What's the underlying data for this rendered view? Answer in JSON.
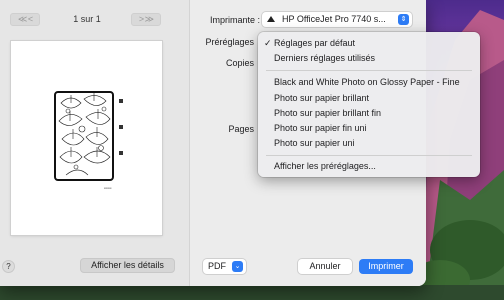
{
  "left_pane": {
    "prev_label": "≪ <",
    "next_label": "> ≫",
    "page_count": "1 sur 1",
    "details_button": "Afficher les détails",
    "help_label": "?"
  },
  "printer": {
    "label": "Imprimante :",
    "value": "HP OfficeJet Pro 7740 s..."
  },
  "presets": {
    "label": "Préréglages",
    "menu": {
      "checkmark": "✓",
      "default": "Réglages par défaut",
      "recent": "Derniers réglages utilisés",
      "items": [
        "Black and White Photo on Glossy Paper - Fine",
        "Photo sur papier brillant",
        "Photo sur papier brillant fin",
        "Photo sur papier fin uni",
        "Photo sur papier uni"
      ],
      "show_presets": "Afficher les préréglages..."
    }
  },
  "copies_label": "Copies",
  "pages_label": "Pages",
  "footer": {
    "pdf_label": "PDF",
    "cancel": "Annuler",
    "print": "Imprimer"
  },
  "colors": {
    "accent": "#2d7cf6"
  }
}
